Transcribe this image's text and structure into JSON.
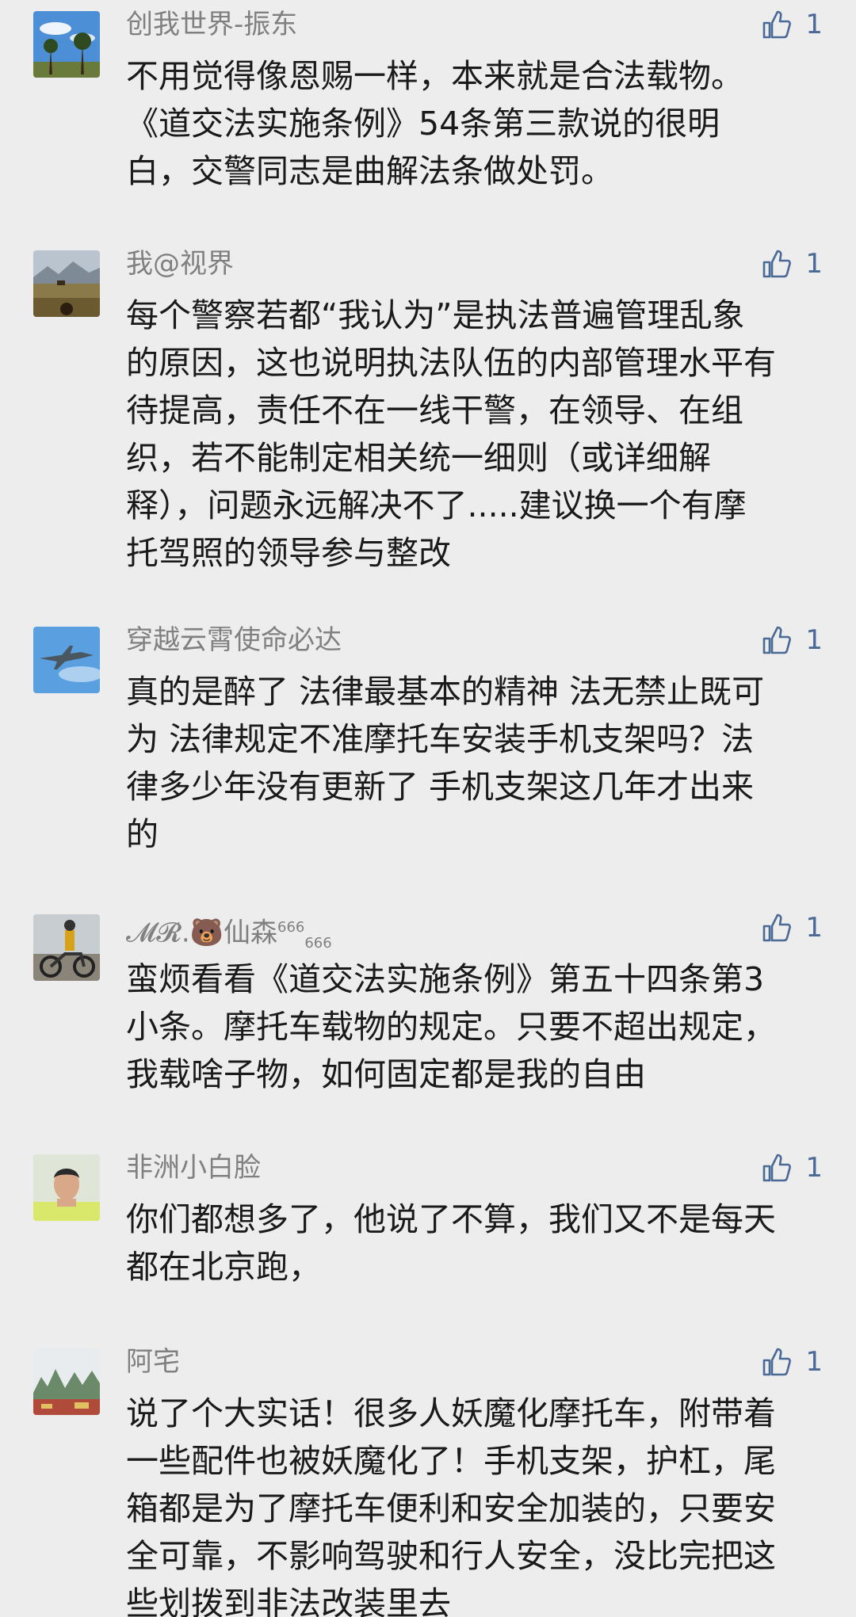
{
  "comments": [
    {
      "nickname": "创我世界-振东",
      "likes": "1",
      "avatar_icon": "sky-tree-avatar",
      "lines": [
        "不用觉得像恩赐一样，本来就是合法载物。",
        "《道交法实施条例》54条第三款说的很明",
        "白，交警同志是曲解法条做处罚。"
      ]
    },
    {
      "nickname": "我@视界",
      "likes": "1",
      "avatar_icon": "grassland-avatar",
      "lines": [
        "每个警察若都“我认为”是执法普遍管理乱象",
        "的原因，这也说明执法队伍的内部管理水平有",
        "待提高，责任不在一线干警，在领导、在组",
        "织，若不能制定相关统一细则（或详细解",
        "释），问题永远解决不了.....建议换一个有摩",
        "托驾照的领导参与整改"
      ]
    },
    {
      "nickname": "穿越云霄使命必达",
      "likes": "1",
      "avatar_icon": "jet-avatar",
      "lines": [
        "真的是醉了 法律最基本的精神 法无禁止既可",
        "为  法律规定不准摩托车安装手机支架吗？法",
        "律多少年没有更新了  手机支架这几年才出来",
        "的"
      ]
    },
    {
      "nickname_prefix": "𝓜𝓡.",
      "nickname_emoji": "🐻",
      "nickname_main": "仙森",
      "nickname_sup": "666",
      "nickname_sub": "666",
      "likes": "1",
      "avatar_icon": "motorbike-avatar",
      "lines": [
        "蛮烦看看《道交法实施条例》第五十四条第3",
        "小条。摩托车载物的规定。只要不超出规定，",
        "我载啥子物，如何固定都是我的自由"
      ]
    },
    {
      "nickname": "非洲小白脸",
      "likes": "1",
      "avatar_icon": "person-avatar",
      "lines": [
        "你们都想多了，他说了不算，我们又不是每天",
        "都在北京跑，"
      ]
    },
    {
      "nickname": "阿宅",
      "likes": "1",
      "avatar_icon": "mountain-avatar",
      "lines": [
        "说了个大实话！很多人妖魔化摩托车，附带着",
        "一些配件也被妖魔化了！手机支架，护杠，尾",
        "箱都是为了摩托车便利和安全加装的，只要安",
        "全可靠，不影响驾驶和行人安全，没比完把这",
        "些划拨到非法改装里去"
      ]
    }
  ],
  "colors": {
    "background": "#ededed",
    "nickname": "#808080",
    "like": "#4a6a96",
    "text": "#1a1a1a"
  }
}
